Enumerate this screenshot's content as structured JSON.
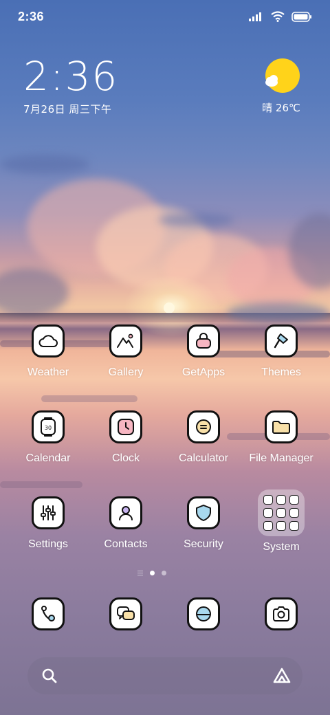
{
  "status_bar": {
    "time": "2:36",
    "icons": [
      "signal-icon",
      "wifi-icon",
      "battery-icon"
    ]
  },
  "clock_widget": {
    "time": "2:36",
    "date": "7月26日 周三下午"
  },
  "weather_widget": {
    "icon": "partly-sunny-icon",
    "condition_temp": "晴 26℃"
  },
  "apps": [
    {
      "label": "Weather",
      "icon": "cloud-icon"
    },
    {
      "label": "Gallery",
      "icon": "mountain-icon"
    },
    {
      "label": "GetApps",
      "icon": "shopping-bag-icon"
    },
    {
      "label": "Themes",
      "icon": "brush-icon"
    },
    {
      "label": "Calendar",
      "icon": "calendar-icon",
      "icon_text": "30"
    },
    {
      "label": "Clock",
      "icon": "clock-icon"
    },
    {
      "label": "Calculator",
      "icon": "calculator-icon"
    },
    {
      "label": "File Manager",
      "icon": "folder-icon"
    },
    {
      "label": "Settings",
      "icon": "sliders-icon"
    },
    {
      "label": "Contacts",
      "icon": "person-icon"
    },
    {
      "label": "Security",
      "icon": "shield-icon"
    },
    {
      "label": "System",
      "icon": "folder-grid-icon"
    }
  ],
  "page_indicator": {
    "pages": 2,
    "current": 1
  },
  "dock": [
    {
      "icon": "phone-icon"
    },
    {
      "icon": "messages-icon"
    },
    {
      "icon": "browser-icon"
    },
    {
      "icon": "camera-icon"
    }
  ],
  "search_bar": {
    "left_icon": "search-icon",
    "right_icon": "assistant-icon"
  },
  "colors": {
    "icon_bg": "#ffffff",
    "icon_outline": "#111111",
    "accent_pink": "#f7b6c2",
    "accent_blue": "#a8d8ee",
    "accent_yellow": "#f8e0a8",
    "sun_yellow": "#ffd31a"
  }
}
